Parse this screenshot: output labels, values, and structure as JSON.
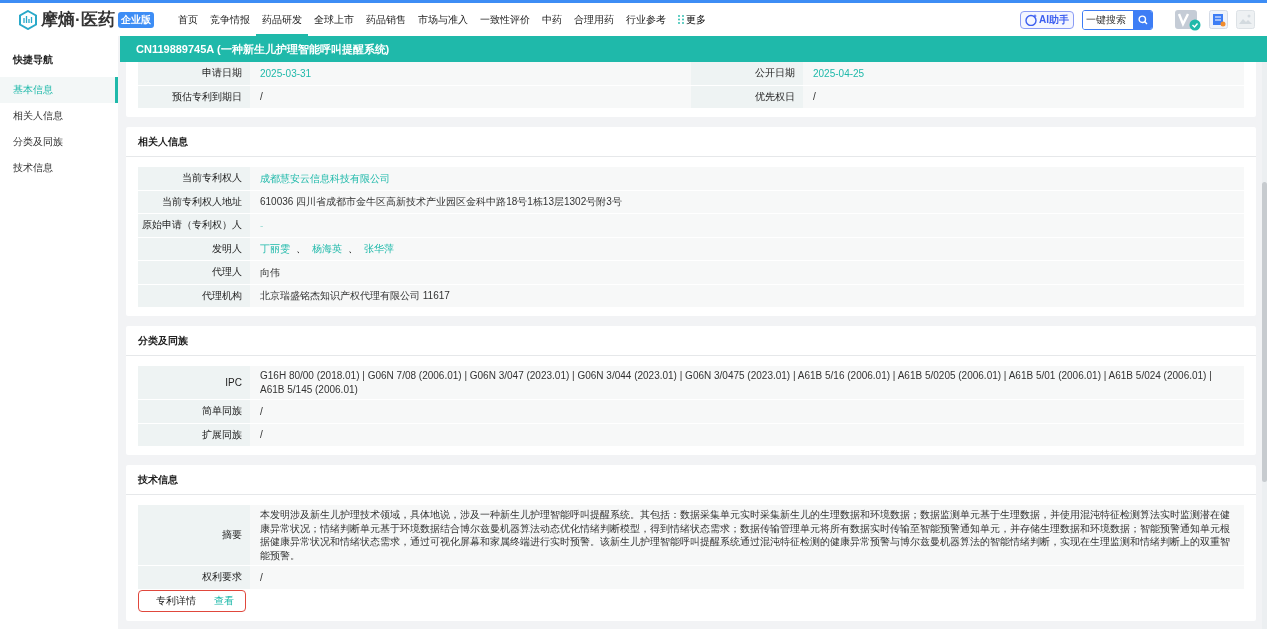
{
  "brand": {
    "name": "摩熵·医药",
    "badge": "企业版"
  },
  "nav": [
    {
      "label": "首页",
      "selected": false
    },
    {
      "label": "竞争情报",
      "selected": false
    },
    {
      "label": "药品研发",
      "selected": true
    },
    {
      "label": "全球上市",
      "selected": false
    },
    {
      "label": "药品销售",
      "selected": false
    },
    {
      "label": "市场与准入",
      "selected": false
    },
    {
      "label": "一致性评价",
      "selected": false
    },
    {
      "label": "中药",
      "selected": false
    },
    {
      "label": "合理用药",
      "selected": false
    },
    {
      "label": "行业参考",
      "selected": false
    }
  ],
  "more": "更多",
  "ai_button": "AI助手",
  "search": {
    "placeholder": "一键搜索"
  },
  "page_title": "CN119889745A (一种新生儿护理智能呼叫提醒系统)",
  "sidebar": {
    "title": "快捷导航",
    "items": [
      {
        "label": "基本信息",
        "selected": true
      },
      {
        "label": "相关人信息",
        "selected": false
      },
      {
        "label": "分类及同族",
        "selected": false
      },
      {
        "label": "技术信息",
        "selected": false
      }
    ]
  },
  "basic_rows": [
    {
      "cells": [
        {
          "label": "申请日期",
          "value": "2025-03-31",
          "kind": "link"
        },
        {
          "label": "公开日期",
          "value": "2025-04-25",
          "kind": "link"
        }
      ]
    },
    {
      "cells": [
        {
          "label": "预估专利到期日",
          "value": "/",
          "kind": "plain"
        },
        {
          "label": "优先权日",
          "value": "/",
          "kind": "plain"
        }
      ]
    }
  ],
  "sections": [
    {
      "title": "相关人信息",
      "rows": [
        {
          "label": "当前专利权人",
          "values": [
            "成都慧安云信息科技有限公司"
          ],
          "kind": "link"
        },
        {
          "label": "当前专利权人地址",
          "values": [
            "610036 四川省成都市金牛区高新技术产业园区金科中路18号1栋13层1302号附3号"
          ],
          "kind": "plain"
        },
        {
          "label": "原始申请（专利权）人",
          "values": [
            "-"
          ],
          "kind": "faint"
        },
        {
          "label": "发明人",
          "values": [
            "丁丽雯",
            "杨海英",
            "张华萍"
          ],
          "separator": "、",
          "kind": "link"
        },
        {
          "label": "代理人",
          "values": [
            "向伟"
          ],
          "kind": "plain"
        },
        {
          "label": "代理机构",
          "values": [
            "北京瑞盛铭杰知识产权代理有限公司 11617"
          ],
          "kind": "plain"
        }
      ]
    },
    {
      "title": "分类及同族",
      "rows": [
        {
          "label": "IPC",
          "values": [
            "G16H 80/00 (2018.01) | G06N 7/08 (2006.01) | G06N 3/047 (2023.01) | G06N 3/044 (2023.01) | G06N 3/0475 (2023.01) | A61B 5/16 (2006.01) | A61B 5/0205 (2006.01) | A61B 5/01 (2006.01) | A61B 5/024 (2006.01) | A61B 5/145 (2006.01)"
          ],
          "kind": "plain"
        },
        {
          "label": "简单同族",
          "values": [
            "/"
          ],
          "kind": "plain"
        },
        {
          "label": "扩展同族",
          "values": [
            "/"
          ],
          "kind": "plain"
        }
      ]
    },
    {
      "title": "技术信息",
      "rows": [
        {
          "label": "摘要",
          "values": [
            "本发明涉及新生儿护理技术领域，具体地说，涉及一种新生儿护理智能呼叫提醒系统。其包括：数据采集单元实时采集新生儿的生理数据和环境数据；数据监测单元基于生理数据，并使用混沌特征检测算法实时监测潜在健康异常状况；情绪判断单元基于环境数据结合博尔兹曼机器算法动态优化情绪判断模型，得到情绪状态需求；数据传输管理单元将所有数据实时传输至智能预警通知单元，并存储生理数据和环境数据；智能预警通知单元根据健康异常状况和情绪状态需求，通过可视化屏幕和家属终端进行实时预警。该新生儿护理智能呼叫提醒系统通过混沌特征检测的健康异常预警与博尔兹曼机器算法的智能情绪判断，实现在生理监测和情绪判断上的双重智能预警。"
          ],
          "kind": "plain"
        },
        {
          "label": "权利要求",
          "values": [
            "/"
          ],
          "kind": "plain"
        },
        {
          "label": "专利详情",
          "values": [
            "查看"
          ],
          "kind": "link",
          "highlighted": true
        }
      ]
    }
  ]
}
